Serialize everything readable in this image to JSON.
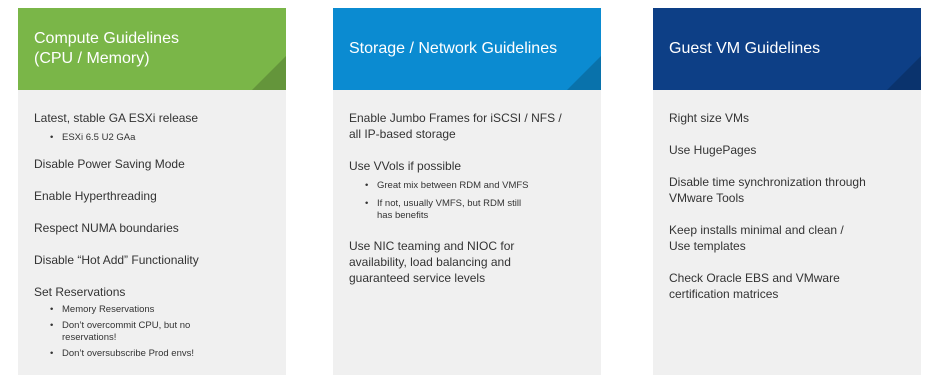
{
  "colors": {
    "panel1_header": "#7ab648",
    "panel2_header": "#0b8bd1",
    "panel3_header": "#0d3f86",
    "panel_body": "#f0f0f0"
  },
  "panels": [
    {
      "title": "Compute Guidelines\n (CPU / Memory)",
      "items": [
        {
          "text": "Latest, stable GA ESXi release",
          "subs": [
            "ESXi 6.5 U2 GAa"
          ]
        },
        {
          "text": "Disable Power Saving Mode",
          "subs": []
        },
        {
          "text": "Enable Hyperthreading",
          "subs": []
        },
        {
          "text": "Respect NUMA boundaries",
          "subs": []
        },
        {
          "text": "Disable “Hot Add” Functionality",
          "subs": []
        },
        {
          "text": "Set Reservations",
          "subs": [
            "Memory Reservations",
            "Don’t overcommit CPU, but no\nreservations!",
            "Don’t oversubscribe Prod envs!"
          ]
        }
      ]
    },
    {
      "title": "Storage / Network Guidelines",
      "items": [
        {
          "text": "Enable Jumbo Frames for iSCSI / NFS /\nall IP-based storage",
          "subs": []
        },
        {
          "text": "Use VVols if possible",
          "subs": [
            "Great mix between RDM and VMFS",
            "If not, usually VMFS, but RDM still\nhas benefits"
          ]
        },
        {
          "text": "Use NIC teaming and NIOC for\navailability, load balancing and\nguaranteed service levels",
          "subs": []
        }
      ]
    },
    {
      "title": "Guest VM Guidelines",
      "items": [
        {
          "text": "Right size VMs",
          "subs": []
        },
        {
          "text": "Use HugePages",
          "subs": []
        },
        {
          "text": "Disable time synchronization through\nVMware Tools",
          "subs": []
        },
        {
          "text": "Keep installs minimal and clean /\nUse templates",
          "subs": []
        },
        {
          "text": "Check Oracle EBS and VMware\ncertification matrices",
          "subs": []
        }
      ]
    }
  ]
}
